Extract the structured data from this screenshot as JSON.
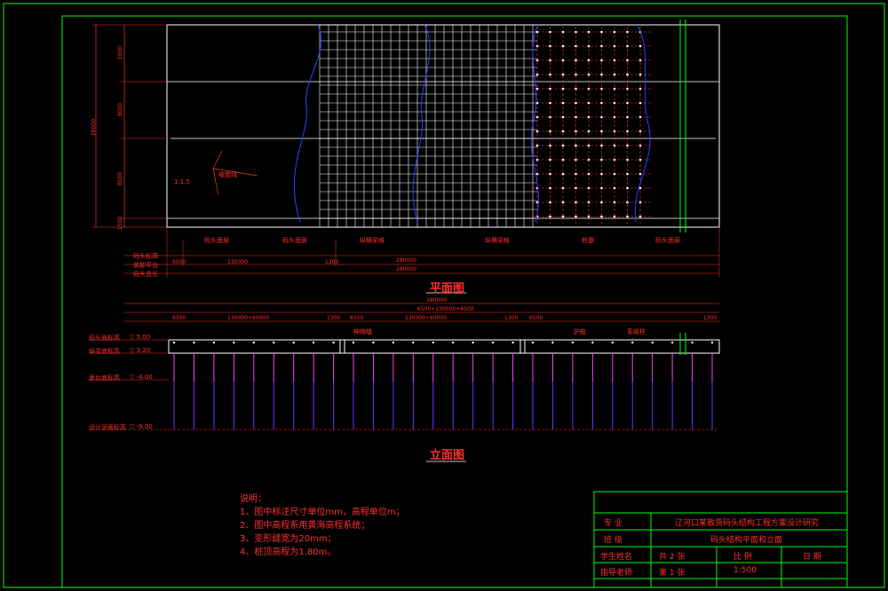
{
  "plan_view": {
    "title": "平面图",
    "overall_width": "280000",
    "overall_width_cl": "280000",
    "bay_dims": [
      "6500",
      "130000",
      "1300"
    ],
    "height_total": "26000",
    "height_dims": [
      "5000",
      "8000",
      "8000",
      "1500"
    ],
    "callouts": [
      "码头面层",
      "码头面层",
      "纵横梁格",
      "纵横梁格",
      "桩基",
      "码头面层"
    ],
    "left_labels": [
      "码头标高",
      "装卸平台",
      "码头总长"
    ],
    "slope_note": "坡度线",
    "slope_ratio": "1:1.5"
  },
  "elevation_view": {
    "title": "立面图",
    "top_dims": [
      "180000",
      "6500+130000+6500"
    ],
    "bay_dims": [
      "6500",
      "130000+60000",
      "1300",
      "6500",
      "130000+60000",
      "1300",
      "6500",
      "1300"
    ],
    "left_labels": [
      "码头面标高",
      "纵梁底标高",
      "承台底标高",
      "设计泥面标高"
    ],
    "elevations": [
      "▽ 5.00",
      "▽ 3.20",
      "▽ -4.00",
      "▽ -9.00"
    ],
    "callouts": [
      "伸缩缝",
      "护舷",
      "系缆柱"
    ],
    "pile_count": 28
  },
  "notes": {
    "heading": "说明：",
    "items": [
      "1、图中标注尺寸单位mm，高程单位m；",
      "2、图中高程系用黄海高程系统；",
      "3、变形缝宽为20mm；",
      "4、桩顶高程为1.80m。"
    ]
  },
  "title_block": {
    "major_label": "专 业",
    "project": "辽河口某散货码头结构工程方案设计研究",
    "class_label": "班 级",
    "drawing_name": "码头结构平面和立面",
    "student_label": "学生姓名",
    "total_sheets": "共 2 张",
    "scale_label": "比 例",
    "date_label": "日 期",
    "advisor_label": "指导老师",
    "sheet_no": "第 1 张",
    "scale_value": "1:500"
  },
  "colors": {
    "frame": "#00ff00",
    "lines": "#ffffff",
    "text": "#ff3030",
    "slope": "#3040ff",
    "pile": "#ff40ff",
    "pile_base": "#7a2cff"
  }
}
